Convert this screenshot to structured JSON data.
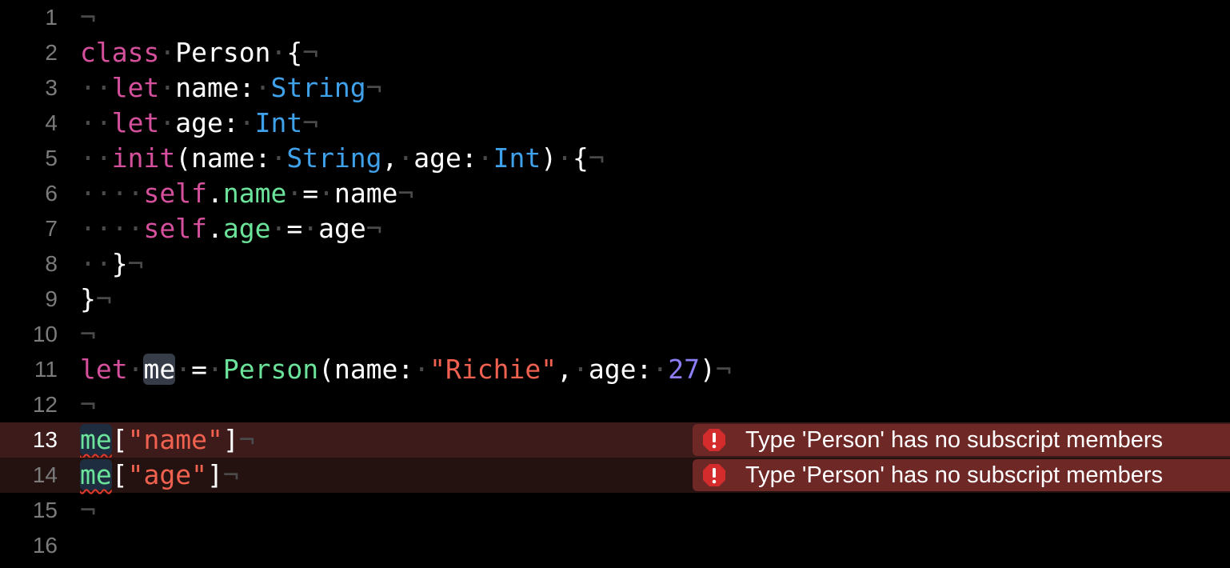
{
  "editor": {
    "lines": [
      {
        "number": "1",
        "text": "¬"
      },
      {
        "number": "2",
        "text": "class·Person·{¬"
      },
      {
        "number": "3",
        "text": "··let·name:·String¬"
      },
      {
        "number": "4",
        "text": "··let·age:·Int¬"
      },
      {
        "number": "5",
        "text": "··init(name:·String,·age:·Int)·{¬"
      },
      {
        "number": "6",
        "text": "····self.name·=·name¬"
      },
      {
        "number": "7",
        "text": "····self.age·=·age¬"
      },
      {
        "number": "8",
        "text": "··}¬"
      },
      {
        "number": "9",
        "text": "}¬"
      },
      {
        "number": "10",
        "text": "¬"
      },
      {
        "number": "11",
        "text": "let·me·=·Person(name:·\"Richie\",·age:·27)¬"
      },
      {
        "number": "12",
        "text": "¬"
      },
      {
        "number": "13",
        "text": "me[\"name\"]¬"
      },
      {
        "number": "14",
        "text": "me[\"age\"]¬"
      },
      {
        "number": "15",
        "text": "¬"
      },
      {
        "number": "16",
        "text": ""
      }
    ],
    "errors": [
      {
        "line": "13",
        "message": "Type 'Person' has no subscript members"
      },
      {
        "line": "14",
        "message": "Type 'Person' has no subscript members"
      }
    ],
    "colors": {
      "background": "#000000",
      "keyword": "#d5509c",
      "type": "#3fa1ea",
      "property": "#6be39a",
      "string": "#f0614f",
      "number": "#8c7ef5",
      "error_banner": "#6e2826",
      "error_icon": "#d42c2c"
    },
    "icons": {
      "error": "exclamation-octagon-icon"
    }
  }
}
